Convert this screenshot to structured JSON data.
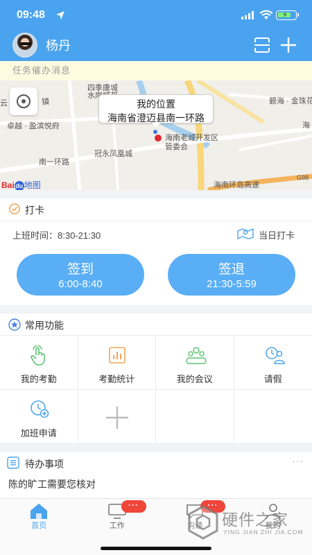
{
  "status_bar": {
    "time": "09:48"
  },
  "header": {
    "username": "杨丹"
  },
  "notice": {
    "text": "任务催办消息"
  },
  "map": {
    "bubble_title": "我的位置",
    "bubble_address": "海南省澄迈县南一环路",
    "labels": [
      "四季康城",
      "水岸城邦",
      "卓越 · 盈滨悦府",
      "南一环路",
      "冠永凤凰城",
      "海南老城开发区",
      "管委会",
      "碧海 · 金珠花",
      "海南环岛高速",
      "G98",
      "云",
      "镇",
      "海"
    ],
    "brand": {
      "bai": "Bai",
      "du": "du",
      "map": "地图"
    }
  },
  "punch": {
    "title": "打卡",
    "work_time": "上班时间：8:30-21:30",
    "day_card": "当日打卡",
    "checkin_label": "签到",
    "checkin_time": "6:00-8:40",
    "checkout_label": "签退",
    "checkout_time": "21:30-5:59"
  },
  "functions": {
    "title": "常用功能",
    "items": [
      {
        "label": "我的考勤",
        "icon": "touch-icon",
        "color": "#5cc473"
      },
      {
        "label": "考勤统计",
        "icon": "stats-icon",
        "color": "#f0a55a"
      },
      {
        "label": "我的会议",
        "icon": "meeting-icon",
        "color": "#5cc473"
      },
      {
        "label": "请假",
        "icon": "leave-icon",
        "color": "#4aa3ee"
      },
      {
        "label": "加班申请",
        "icon": "overtime-icon",
        "color": "#4aa3ee"
      },
      {
        "label": "",
        "icon": "add-icon",
        "color": "#bbbbbb"
      }
    ]
  },
  "todo": {
    "title": "待办事项",
    "more": "···",
    "items": [
      "陈的旷工需要您核对"
    ]
  },
  "tabbar": {
    "tabs": [
      {
        "label": "首页",
        "active": true
      },
      {
        "label": "工作",
        "badge": "···"
      },
      {
        "label": "沟通",
        "badge": "···"
      },
      {
        "label": "我的"
      }
    ]
  },
  "watermark": {
    "text": "硬件之家",
    "sub": "YING JIAN ZHI JIA.COM"
  },
  "colors": {
    "header": "#4aa3ee",
    "button": "#5aaef5",
    "badge": "#f0453a",
    "notice_bg": "#fffbe0"
  }
}
